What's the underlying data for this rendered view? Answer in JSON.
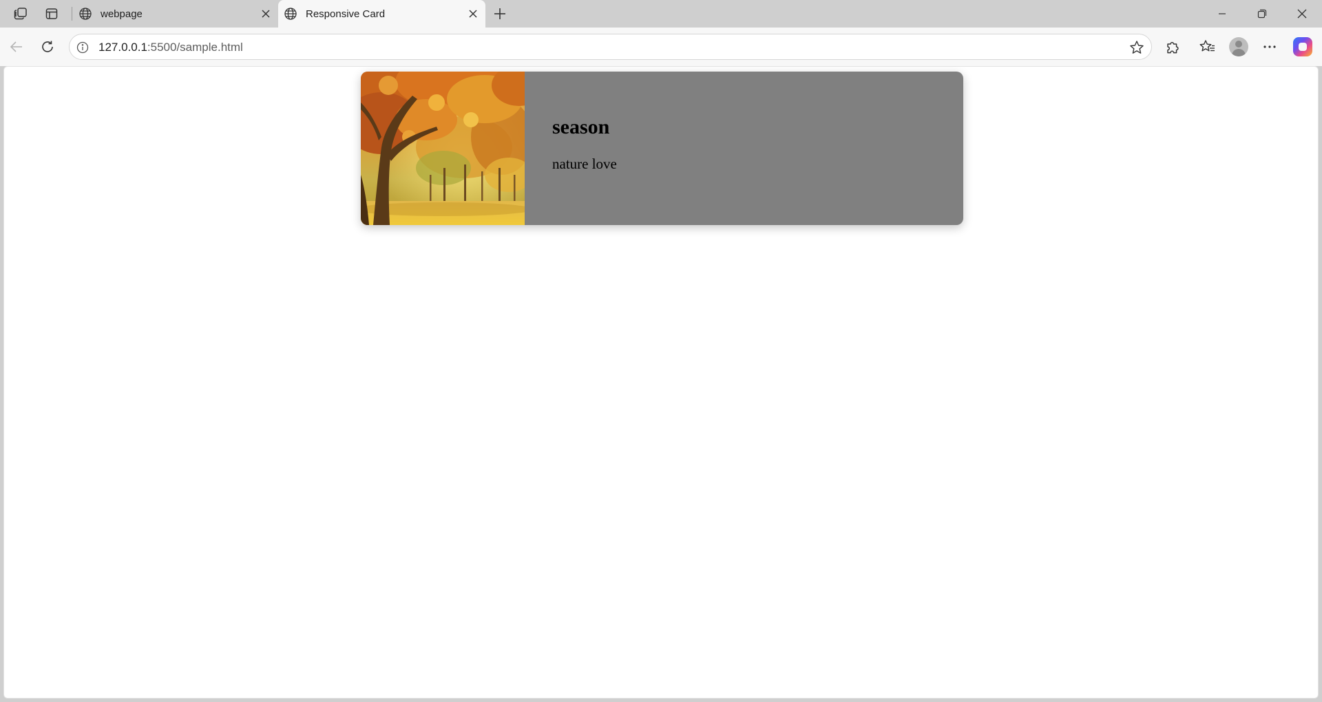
{
  "browser": {
    "tabs": [
      {
        "title": "webpage",
        "active": false
      },
      {
        "title": "Responsive Card",
        "active": true
      }
    ],
    "url": {
      "host": "127.0.0.1",
      "path": ":5500/sample.html"
    }
  },
  "icons": {
    "workspaces": "workspaces-icon",
    "vertical_tabs": "vertical-tabs-icon",
    "favicon": "globe-icon",
    "close": "close-icon",
    "new_tab": "plus-icon",
    "back": "back-arrow-icon",
    "refresh": "refresh-icon",
    "site_info": "info-icon",
    "favorite": "star-icon",
    "extensions": "puzzle-icon",
    "favorites": "favorites-icon",
    "profile": "profile-icon",
    "more": "more-icon",
    "copilot": "copilot-icon"
  },
  "card": {
    "title": "season",
    "text": "nature love",
    "image": "autumn-trees-image"
  },
  "colors": {
    "card_background": "#808080",
    "chrome_background": "#cfcfcf",
    "toolbar_background": "#f7f7f7",
    "page_background": "#ffffff"
  }
}
